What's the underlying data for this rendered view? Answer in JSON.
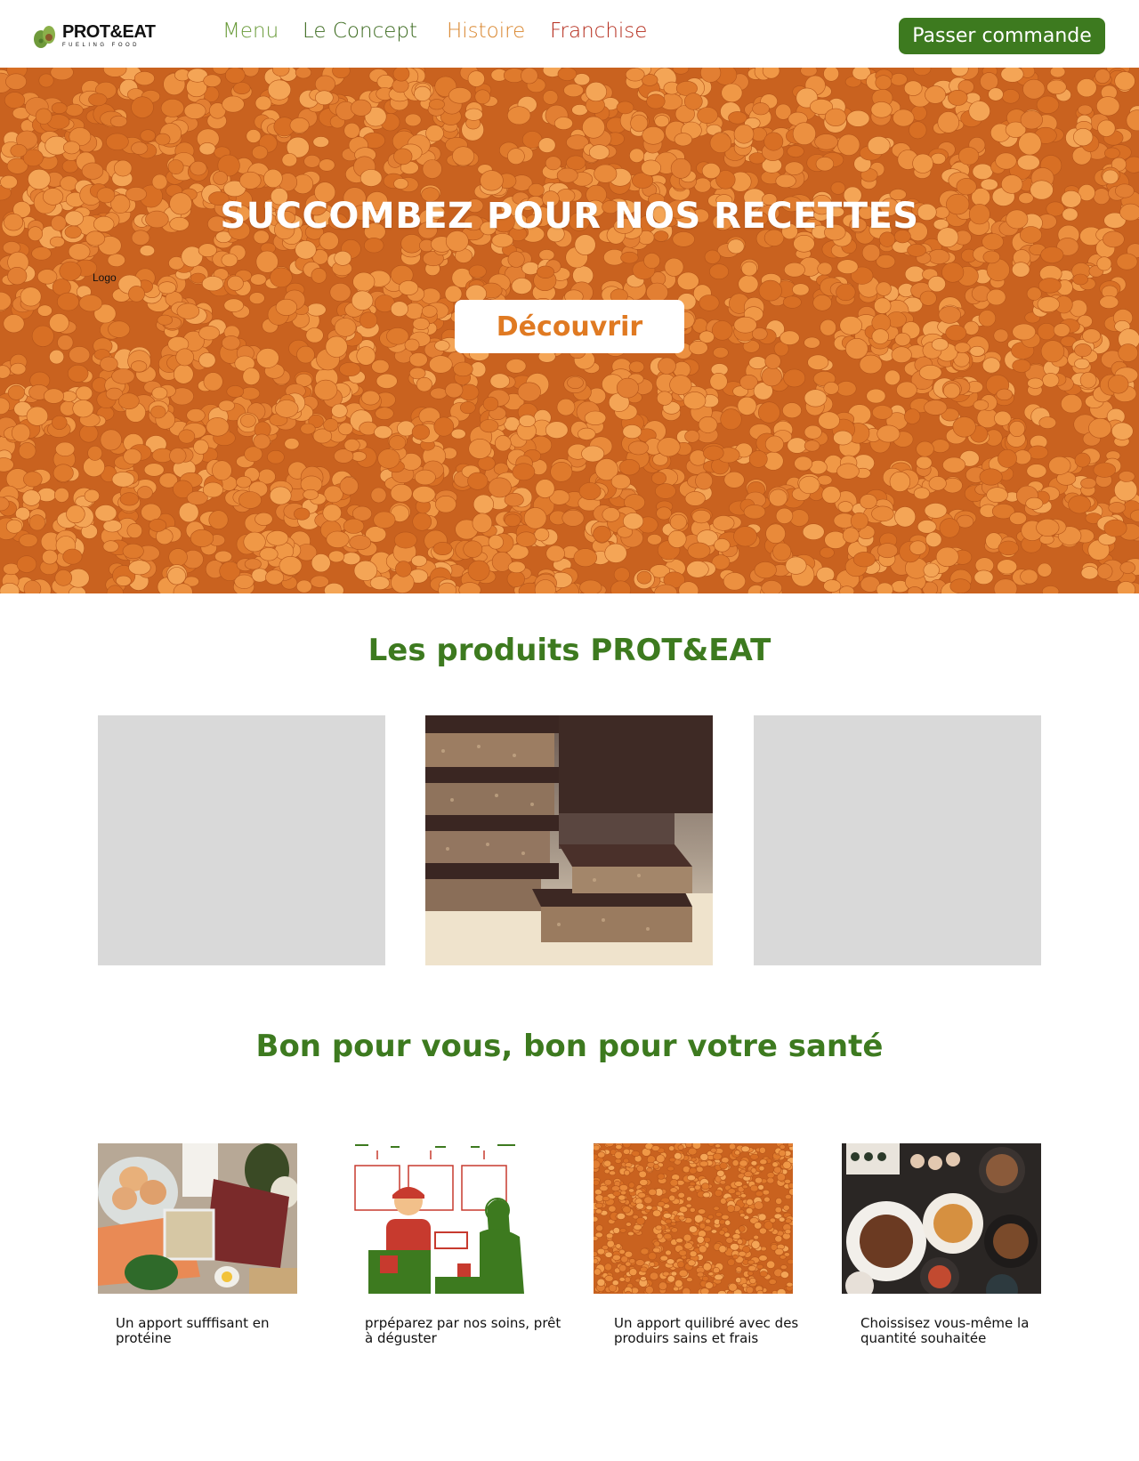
{
  "header": {
    "logo": {
      "name": "PROT&EAT",
      "tagline": "FUELING FOOD"
    },
    "nav": [
      {
        "label": "Menu",
        "color": "#6a9b3a"
      },
      {
        "label": "Le Concept",
        "color": "#3c6b1f"
      },
      {
        "label": "Histoire",
        "color": "#d9862e"
      },
      {
        "label": "Franchise",
        "color": "#b42a1a"
      }
    ],
    "order_button": {
      "label": "Passer commande",
      "color": "#3d7a1f"
    }
  },
  "hero": {
    "title": "SUCCOMBEZ POUR NOS RECETTES",
    "logo_label": "Logo",
    "button": {
      "label": "Découvrir",
      "color": "#e07a22"
    }
  },
  "products": {
    "title": "Les produits PROT&EAT",
    "title_color": "#3d7a1f"
  },
  "benefits": {
    "title": "Bon pour vous, bon pour votre santé",
    "title_color": "#3d7a1f",
    "items": [
      {
        "text": "Un apport sufffisant en protéine"
      },
      {
        "text": "prpéparez par nos soins, prêt à déguster"
      },
      {
        "text": "Un apport quilibré avec des produirs sains et frais"
      },
      {
        "text": "Choissisez vous-même la quantité souhaitée"
      }
    ]
  }
}
